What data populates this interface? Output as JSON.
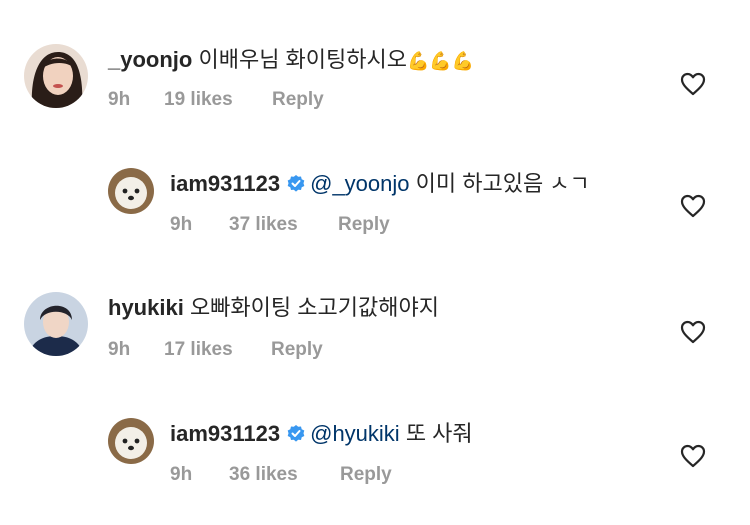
{
  "comments": [
    {
      "username": "_yoonjo",
      "text": "이배우님 화이팅하시오",
      "emoji": "💪💪💪",
      "time": "9h",
      "likes": "19 likes",
      "reply": "Reply"
    },
    {
      "username": "iam931123",
      "verified": true,
      "mention": "@_yoonjo",
      "text": "이미 하고있음 ㅅㄱ",
      "time": "9h",
      "likes": "37 likes",
      "reply": "Reply"
    },
    {
      "username": "hyukiki",
      "text": "오빠화이팅 소고기값해야지",
      "time": "9h",
      "likes": "17 likes",
      "reply": "Reply"
    },
    {
      "username": "iam931123",
      "verified": true,
      "mention": "@hyukiki",
      "text": "또 사줘",
      "time": "9h",
      "likes": "36 likes",
      "reply": "Reply"
    }
  ],
  "colors": {
    "text": "#262626",
    "muted": "#999999",
    "mention": "#003569",
    "verified": "#3897f0"
  },
  "icons": {
    "like": "heart-outline-icon",
    "verified": "verified-badge-icon"
  }
}
